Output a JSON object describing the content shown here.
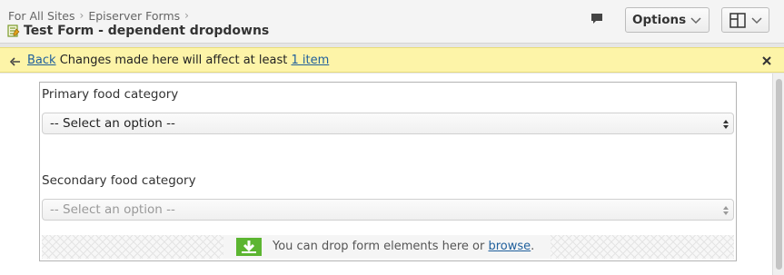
{
  "header": {
    "breadcrumbs": [
      "For All Sites",
      "Episerver Forms"
    ],
    "title": "Test Form - dependent dropdowns",
    "options_label": "Options"
  },
  "notification": {
    "back_label": "Back",
    "message_before": "Changes made here will affect at least",
    "item_link": "1 item"
  },
  "form": {
    "fields": [
      {
        "label": "Primary food category",
        "selected": "-- Select an option --",
        "disabled": false
      },
      {
        "label": "Secondary food category",
        "selected": "-- Select an option --",
        "disabled": true
      }
    ],
    "drop_zone": {
      "text": "You can drop form elements here or",
      "browse_link": "browse",
      "suffix": "."
    }
  },
  "colors": {
    "notify_bg": "#fdf4a8",
    "link": "#1f5f9c",
    "drop_icon": "#5cb531"
  },
  "icons": {
    "page": "form-page-icon",
    "comment": "comment-icon",
    "view": "layout-panel-icon",
    "back": "back-arrow-icon",
    "close": "close-icon",
    "drop": "drop-down-arrow-icon"
  }
}
